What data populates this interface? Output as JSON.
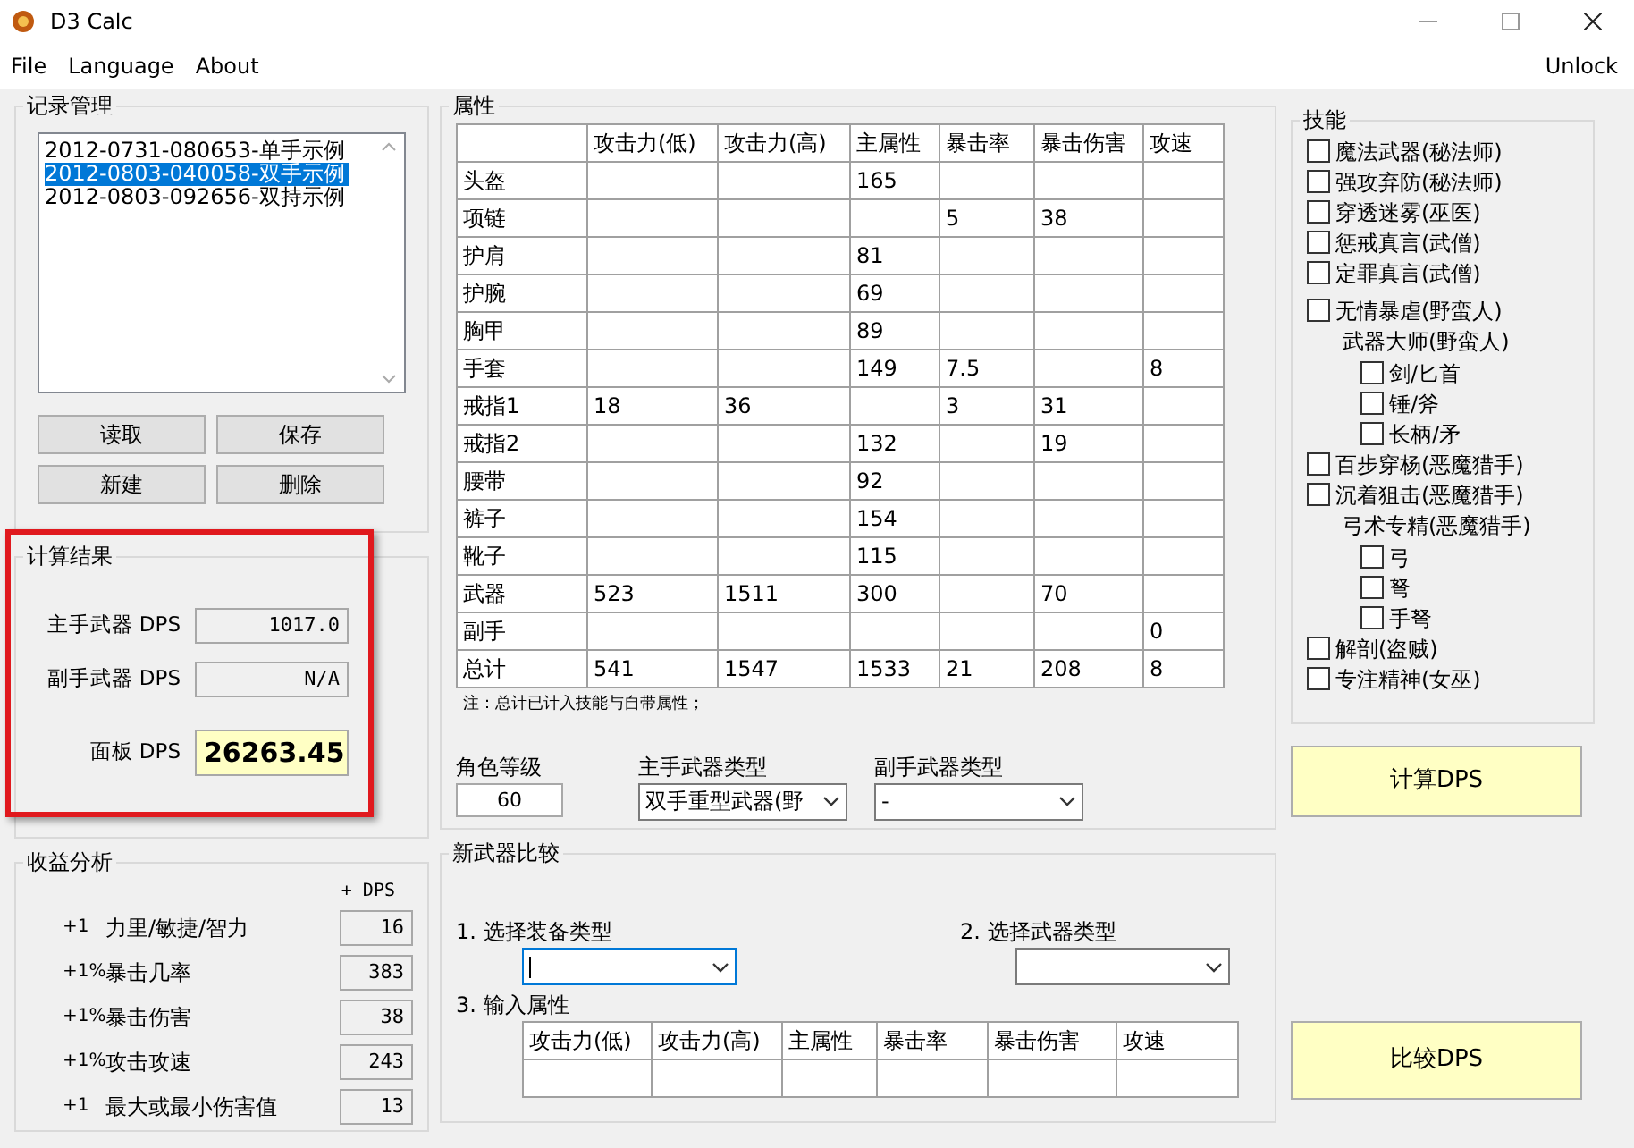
{
  "window": {
    "title": "D3 Calc"
  },
  "menu": [
    "File",
    "Language",
    "About"
  ],
  "menu_right": "Unlock",
  "records": {
    "title": "记录管理",
    "items": [
      {
        "label": "2012-0731-080653-单手示例",
        "selected": false
      },
      {
        "label": "2012-0803-040058-双手示例",
        "selected": true
      },
      {
        "label": "2012-0803-092656-双持示例",
        "selected": false
      }
    ],
    "buttons": [
      "读取",
      "保存",
      "新建",
      "删除"
    ]
  },
  "results": {
    "title": "计算结果",
    "highlighted": true,
    "fields": [
      {
        "kind": "plain",
        "label": "主手武器 DPS",
        "value": "1017.0"
      },
      {
        "kind": "plain",
        "label": "副手武器 DPS",
        "value": "N/A"
      },
      {
        "kind": "emphasis",
        "label": "面板 DPS",
        "value": "26263.45"
      }
    ]
  },
  "gains": {
    "title": "收益分析",
    "column_header": "+ DPS",
    "rows": [
      {
        "prefix": "+1",
        "label": "力里/敏捷/智力",
        "value": "16"
      },
      {
        "prefix": "+1%",
        "label": "暴击几率",
        "value": "383"
      },
      {
        "prefix": "+1%",
        "label": "暴击伤害",
        "value": "38"
      },
      {
        "prefix": "+1%",
        "label": "攻击攻速",
        "value": "243"
      },
      {
        "prefix": "+1",
        "label": "最大或最小伤害值",
        "value": "13"
      }
    ]
  },
  "attributes": {
    "title": "属性",
    "columns": [
      "攻击力(低)",
      "攻击力(高)",
      "主属性",
      "暴击率",
      "暴击伤害",
      "攻速"
    ],
    "rows": [
      {
        "label": "头盔",
        "cells": [
          null,
          null,
          "165",
          null,
          null,
          null
        ]
      },
      {
        "label": "项链",
        "cells": [
          null,
          null,
          null,
          "5",
          "38",
          null
        ]
      },
      {
        "label": "护肩",
        "cells": [
          null,
          null,
          "81",
          null,
          null,
          null
        ]
      },
      {
        "label": "护腕",
        "cells": [
          null,
          null,
          "69",
          null,
          null,
          null
        ]
      },
      {
        "label": "胸甲",
        "cells": [
          null,
          null,
          "89",
          null,
          null,
          null
        ]
      },
      {
        "label": "手套",
        "cells": [
          null,
          null,
          "149",
          "7.5",
          null,
          "8"
        ]
      },
      {
        "label": "戒指1",
        "cells": [
          "18",
          "36",
          null,
          "3",
          "31",
          null
        ]
      },
      {
        "label": "戒指2",
        "cells": [
          null,
          null,
          "132",
          null,
          "19",
          null
        ]
      },
      {
        "label": "腰带",
        "cells": [
          null,
          null,
          "92",
          null,
          null,
          null
        ]
      },
      {
        "label": "裤子",
        "cells": [
          null,
          null,
          "154",
          null,
          null,
          null
        ]
      },
      {
        "label": "靴子",
        "cells": [
          null,
          null,
          "115",
          null,
          null,
          null
        ]
      },
      {
        "label": "武器",
        "cells": [
          "523",
          "1511",
          "300",
          null,
          "70",
          null
        ]
      },
      {
        "label": "副手",
        "cells": [
          null,
          null,
          null,
          null,
          null,
          "0"
        ]
      },
      {
        "label": "总计",
        "cells": [
          "541",
          "1547",
          "1533",
          "21",
          "208",
          "8"
        ]
      }
    ],
    "note": "注：总计已计入技能与自带属性；"
  },
  "character": {
    "level_label": "角色等级",
    "level": "60",
    "main_weapon_label": "主手武器类型",
    "main_weapon": "双手重型武器(野",
    "off_weapon_label": "副手武器类型",
    "off_weapon": "-"
  },
  "skills": {
    "title": "技能",
    "items": [
      {
        "kind": "check",
        "label": "魔法武器(秘法师)",
        "checked": false
      },
      {
        "kind": "check",
        "label": "强攻弃防(秘法师)",
        "checked": false
      },
      {
        "kind": "check",
        "label": "穿透迷雾(巫医)",
        "checked": false
      },
      {
        "kind": "check",
        "label": "惩戒真言(武僧)",
        "checked": false
      },
      {
        "kind": "check",
        "label": "定罪真言(武僧)",
        "checked": false
      },
      {
        "kind": "check",
        "label": "无情暴虐(野蛮人)",
        "checked": false
      },
      {
        "kind": "group",
        "label": "武器大师(野蛮人)",
        "children": [
          {
            "kind": "check",
            "label": "剑/匕首",
            "checked": false
          },
          {
            "kind": "check",
            "label": "锤/斧",
            "checked": false
          },
          {
            "kind": "check",
            "label": "长柄/矛",
            "checked": false
          }
        ]
      },
      {
        "kind": "check",
        "label": "百步穿杨(恶魔猎手)",
        "checked": false
      },
      {
        "kind": "check",
        "label": "沉着狙击(恶魔猎手)",
        "checked": false
      },
      {
        "kind": "group",
        "label": "弓术专精(恶魔猎手)",
        "children": [
          {
            "kind": "check",
            "label": "弓",
            "checked": false
          },
          {
            "kind": "check",
            "label": "弩",
            "checked": false
          },
          {
            "kind": "check",
            "label": "手弩",
            "checked": false
          }
        ]
      },
      {
        "kind": "check",
        "label": "解剖(盗贼)",
        "checked": false
      },
      {
        "kind": "check",
        "label": "专注精神(女巫)",
        "checked": false
      }
    ]
  },
  "calc_button": "计算DPS",
  "compare": {
    "title": "新武器比较",
    "step1_label": "1. 选择装备类型",
    "step2_label": "2. 选择武器类型",
    "step3_label": "3. 输入属性",
    "columns": [
      "攻击力(低)",
      "攻击力(高)",
      "主属性",
      "暴击率",
      "暴击伤害",
      "攻速"
    ],
    "button": "比较DPS"
  }
}
